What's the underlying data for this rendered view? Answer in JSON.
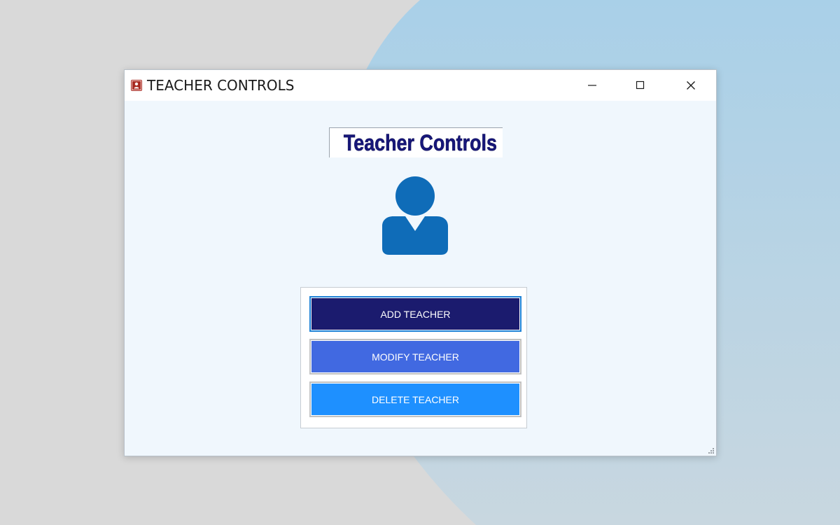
{
  "window": {
    "title": "TEACHER CONTROLS",
    "app_icon": "teacher-app-icon",
    "controls": [
      "minimize-icon",
      "maximize-icon",
      "close-icon"
    ]
  },
  "content": {
    "logo_text": "Teacher Controls",
    "avatar_icon": "user-icon"
  },
  "buttons": {
    "add_label": "ADD TEACHER",
    "modify_label": "MODIFY TEACHER",
    "delete_label": "DELETE TEACHER"
  },
  "colors": {
    "window_background": "#f0f7fd",
    "logo_text": "#17177a",
    "avatar": "#0f6cb8",
    "add_button": "#1b1b6e",
    "modify_button": "#4169e1",
    "delete_button": "#1e90ff",
    "app_icon": "#a82a22"
  }
}
